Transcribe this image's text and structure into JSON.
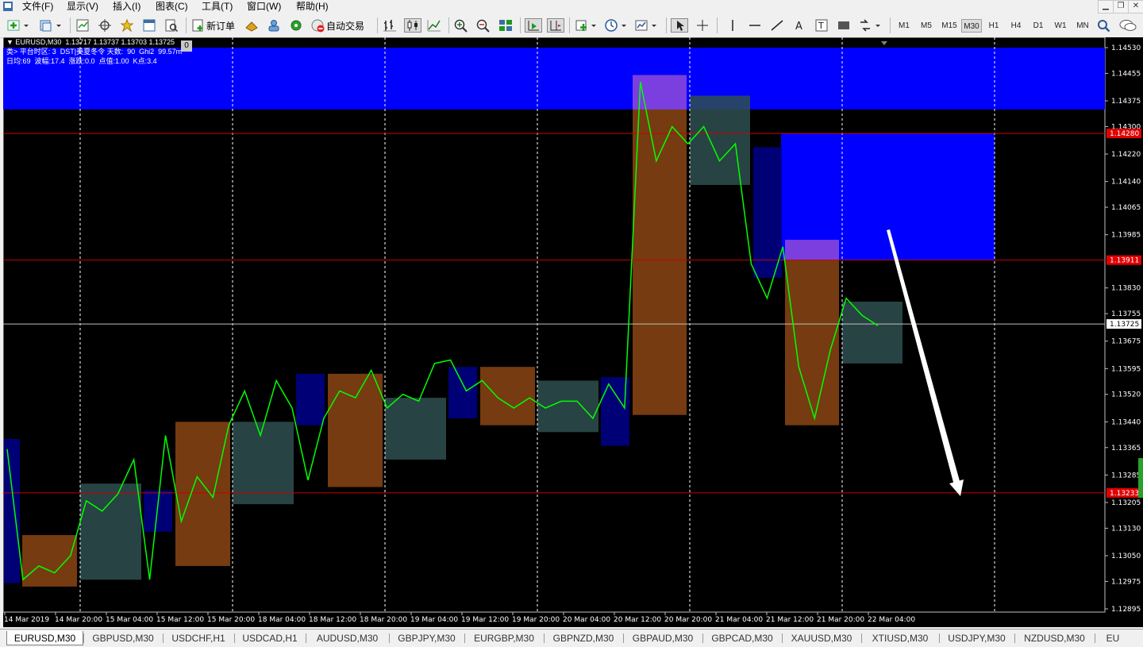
{
  "menu": [
    "文件(F)",
    "显示(V)",
    "插入(I)",
    "图表(C)",
    "工具(T)",
    "窗口(W)",
    "帮助(H)"
  ],
  "toolbar": {
    "new_order": "新订单",
    "auto_trading": "自动交易",
    "timeframes": [
      "M1",
      "M5",
      "M15",
      "M30",
      "H1",
      "H4",
      "D1",
      "W1",
      "MN"
    ],
    "active_timeframe": "M30"
  },
  "chart": {
    "symbol_line": "EURUSD,M30  1.13717 1.13737 1.13703 1.13725",
    "corner_badge": "0",
    "info_line1": "类> 平台时区: 3  DST|美夏冬令 天数:  90  Ghi2  99.57m",
    "info_line2": "日均:69  波幅:17.4  涨跌:0.0  点值:1.00  K点:3.4"
  },
  "chart_data": {
    "type": "line",
    "symbol": "EURUSD",
    "timeframe": "M30",
    "current_price": 1.13725,
    "price_labels": [
      "1.14530",
      "1.14455",
      "1.14375",
      "1.14300",
      "1.14220",
      "1.14140",
      "1.14065",
      "1.13985",
      "1.13830",
      "1.13755",
      "1.13675",
      "1.13595",
      "1.13520",
      "1.13440",
      "1.13365",
      "1.13285",
      "1.13205",
      "1.13130",
      "1.13050",
      "1.12975",
      "1.12895"
    ],
    "horizontal_lines": [
      {
        "price": 1.1428,
        "label": "1.14280",
        "color": "#cc0000"
      },
      {
        "price": 1.13911,
        "label": "1.13911",
        "color": "#cc0000"
      },
      {
        "price": 1.13725,
        "label": "1.13725",
        "color": "#c0c0c0"
      },
      {
        "price": 1.13233,
        "label": "1.13233",
        "color": "#cc0000"
      }
    ],
    "time_labels": [
      "14 Mar 2019",
      "14 Mar 20:00",
      "15 Mar 04:00",
      "15 Mar 12:00",
      "15 Mar 20:00",
      "18 Mar 04:00",
      "18 Mar 12:00",
      "18 Mar 20:00",
      "19 Mar 04:00",
      "19 Mar 12:00",
      "19 Mar 20:00",
      "20 Mar 04:00",
      "20 Mar 12:00",
      "20 Mar 20:00",
      "21 Mar 04:00",
      "21 Mar 12:00",
      "21 Mar 20:00",
      "22 Mar 04:00"
    ],
    "zones": [
      {
        "color": "#0000ff",
        "top": 1.1453,
        "bottom": 1.1435
      },
      {
        "color": "#0000ff",
        "top": 1.1428,
        "bottom": 1.13911
      },
      {
        "color": "#8b4513",
        "top": 1.1445,
        "bottom": 1.1346
      },
      {
        "color": "#8b4513",
        "top": 1.1397,
        "bottom": 1.1343
      },
      {
        "color": "#2f4f4f",
        "top": 1.1439,
        "bottom": 1.1413
      },
      {
        "color": "#2f4f4f",
        "top": 1.1379,
        "bottom": 1.1361
      },
      {
        "color": "#00008b",
        "top": 1.1424,
        "bottom": 1.1386
      }
    ],
    "series": [
      {
        "color": "#00ff00",
        "values": [
          1.1336,
          1.1298,
          1.1302,
          1.13,
          1.1305,
          1.1321,
          1.1318,
          1.1323,
          1.1333,
          1.1298,
          1.134,
          1.1315,
          1.1328,
          1.1322,
          1.1343,
          1.1353,
          1.134,
          1.1356,
          1.1348,
          1.1327,
          1.1345,
          1.1353,
          1.1351,
          1.1359,
          1.1348,
          1.1352,
          1.135,
          1.1361,
          1.1362,
          1.1353,
          1.1356,
          1.1351,
          1.1348,
          1.1351,
          1.1348,
          1.135,
          1.135,
          1.1345,
          1.1355,
          1.1348,
          1.1443,
          1.142,
          1.143,
          1.1425,
          1.143,
          1.142,
          1.1425,
          1.139,
          1.138,
          1.1395,
          1.136,
          1.1345,
          1.1365,
          1.138,
          1.1375,
          1.1372
        ]
      }
    ],
    "arrow": {
      "from": {
        "time": "21 Mar 22:00",
        "price": 1.1399
      },
      "to": {
        "time": "22 Mar 06:00",
        "price": 1.1324
      }
    }
  },
  "tabs": [
    "EURUSD,M30",
    "GBPUSD,M30",
    "USDCHF,H1",
    "USDCAD,H1",
    "AUDUSD,M30",
    "GBPJPY,M30",
    "EURGBP,M30",
    "GBPNZD,M30",
    "GBPAUD,M30",
    "GBPCAD,M30",
    "XAUUSD,M30",
    "XTIUSD,M30",
    "USDJPY,M30",
    "NZDUSD,M30",
    "EU"
  ],
  "active_tab": "EURUSD,M30"
}
